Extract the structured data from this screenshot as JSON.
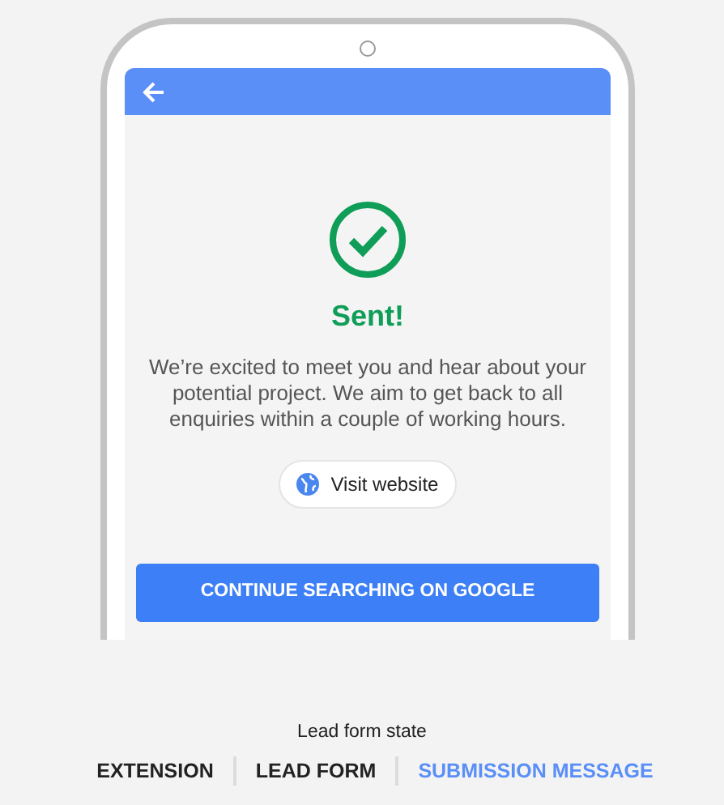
{
  "screen": {
    "status": {
      "title": "Sent!",
      "message": "We’re excited to meet you and hear about your potential project. We aim to get back to all enquiries within a couple of working hours."
    },
    "visit_button": {
      "label": "Visit website"
    },
    "continue_button": {
      "label": "CONTINUE SEARCHING ON GOOGLE"
    }
  },
  "state_picker": {
    "label": "Lead form state",
    "tabs": [
      {
        "label": "EXTENSION",
        "selected": false
      },
      {
        "label": "LEAD FORM",
        "selected": false
      },
      {
        "label": "SUBMISSION MESSAGE",
        "selected": true
      }
    ]
  }
}
